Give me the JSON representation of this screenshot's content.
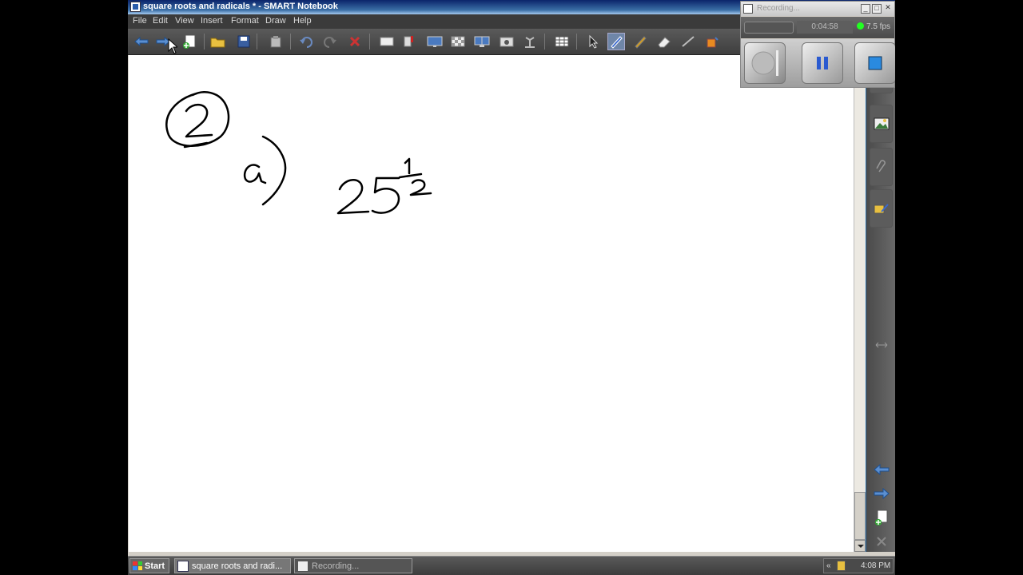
{
  "window": {
    "title": "square roots and radicals * - SMART Notebook"
  },
  "menu": {
    "items": [
      "File",
      "Edit",
      "View",
      "Insert",
      "Format",
      "Draw",
      "Help"
    ]
  },
  "colors": {
    "titlebar": "#0a246a",
    "menubar": "#3b3b3b",
    "canvas": "#ffffff",
    "ink": "#000000",
    "side_accent": "#2a6ea8",
    "recording_led": "#22ff22"
  },
  "toolbar": {
    "icons": [
      "back-arrow-icon",
      "forward-arrow-icon",
      "add-page-icon",
      "open-folder-icon",
      "save-icon",
      "paste-icon",
      "undo-icon",
      "redo-icon",
      "delete-icon",
      "screen-shade-icon",
      "show-hide-icon",
      "full-screen-icon",
      "transparent-background-icon",
      "dual-page-icon",
      "screen-capture-icon",
      "document-camera-icon",
      "table-icon",
      "select-pointer-icon",
      "pen-icon",
      "creative-pen-icon",
      "eraser-icon",
      "line-icon",
      "fill-icon"
    ]
  },
  "canvas_ink": {
    "strokes_description_icons": [
      "circled-number-icon",
      "letter-a-paren-icon",
      "expression-icon"
    ]
  },
  "sidebar": {
    "tabs": [
      "page-sorter-icon",
      "gallery-icon",
      "attachments-icon",
      "properties-icon"
    ],
    "nav": [
      "previous-page-icon",
      "next-page-icon",
      "add-page-icon",
      "delete-page-icon"
    ]
  },
  "recorder": {
    "title": "Recording...",
    "elapsed": "0:04:58",
    "fps": "7.5 fps",
    "state": "recording"
  },
  "taskbar": {
    "start_label": "Start",
    "tasks": [
      {
        "label": "square roots and radi...",
        "active": true
      },
      {
        "label": "Recording...",
        "active": false
      }
    ],
    "tray_expand": "«",
    "clock": "4:08 PM"
  }
}
